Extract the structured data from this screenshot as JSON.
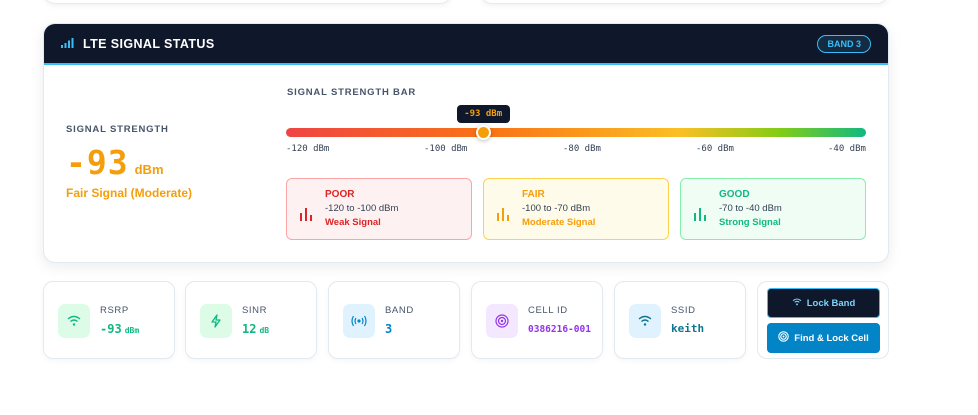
{
  "header": {
    "title": "LTE SIGNAL STATUS",
    "band_badge": "BAND 3"
  },
  "strength": {
    "label": "SIGNAL STRENGTH",
    "value": "-93",
    "unit": "dBm",
    "description": "Fair Signal (Moderate)"
  },
  "bar": {
    "title": "SIGNAL STRENGTH BAR",
    "indicator": "-93 dBm",
    "position_fraction": 0.34,
    "ticks": [
      "-120 dBm",
      "-100 dBm",
      "-80 dBm",
      "-60 dBm",
      "-40 dBm"
    ]
  },
  "ranges": [
    {
      "name": "POOR",
      "range": "-120 to -100 dBm",
      "desc": "Weak Signal",
      "color": "#dc2626"
    },
    {
      "name": "FAIR",
      "range": "-100 to -70 dBm",
      "desc": "Moderate Signal",
      "color": "#f59e0b"
    },
    {
      "name": "GOOD",
      "range": "-70 to -40 dBm",
      "desc": "Strong Signal",
      "color": "#10b981"
    }
  ],
  "stats": [
    {
      "label": "RSRP",
      "value": "-93",
      "unit": "dBm",
      "icon": "wifi-icon",
      "color": "#10b981"
    },
    {
      "label": "SINR",
      "value": "12",
      "unit": "dB",
      "icon": "bolt-icon",
      "color": "#10b981"
    },
    {
      "label": "BAND",
      "value": "3",
      "unit": "",
      "icon": "broadcast-icon",
      "color": "#0284c7"
    },
    {
      "label": "CELL ID",
      "value": "0386216-001",
      "unit": "",
      "icon": "target-icon",
      "color": "#9333ea"
    },
    {
      "label": "SSID",
      "value": "keith",
      "unit": "",
      "icon": "wifi-icon",
      "color": "#0e7490"
    }
  ],
  "actions": {
    "lock_band": "Lock Band",
    "find_lock_cell": "Find & Lock Cell"
  },
  "colors": {
    "header_bg": "#0f172a",
    "accent": "#38bdf8",
    "fair": "#f59e0b"
  }
}
